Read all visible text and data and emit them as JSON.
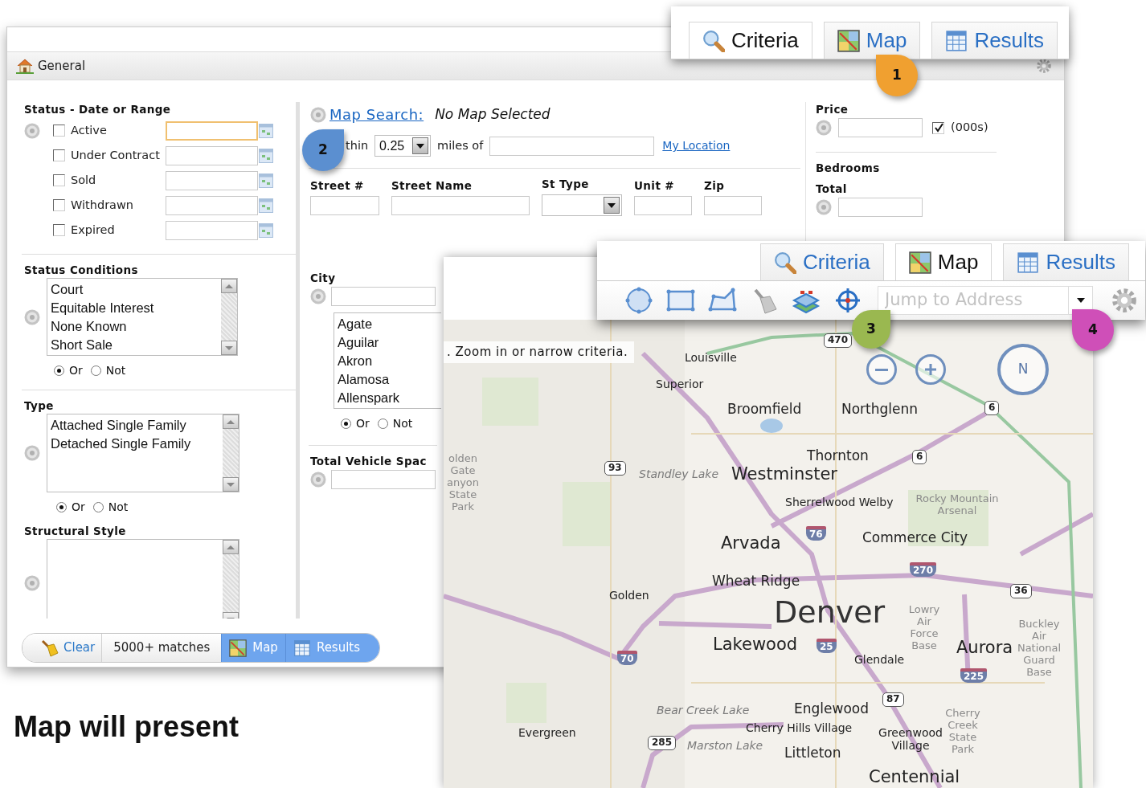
{
  "criteria_window": {
    "header": {
      "title": "General"
    },
    "status_dates": {
      "title": "Status - Date or Range",
      "items": [
        {
          "label": "Active",
          "checked": false,
          "focused": true
        },
        {
          "label": "Under Contract",
          "checked": false,
          "focused": false
        },
        {
          "label": "Sold",
          "checked": false,
          "focused": false
        },
        {
          "label": "Withdrawn",
          "checked": false,
          "focused": false
        },
        {
          "label": "Expired",
          "checked": false,
          "focused": false
        }
      ]
    },
    "status_conditions": {
      "title": "Status Conditions",
      "options": [
        "Court",
        "Equitable Interest",
        "None Known",
        "Short Sale"
      ],
      "logic": [
        {
          "label": "Or",
          "selected": true
        },
        {
          "label": "Not",
          "selected": false
        }
      ]
    },
    "type": {
      "title": "Type",
      "options": [
        "Attached Single Family",
        "Detached Single Family"
      ],
      "logic": [
        {
          "label": "Or",
          "selected": true
        },
        {
          "label": "Not",
          "selected": false
        }
      ]
    },
    "structural_style": {
      "title": "Structural Style"
    },
    "map_search": {
      "link": "Map Search:",
      "status": "No Map Selected",
      "within_label": "thin",
      "radius": "0.25",
      "miles_label": "miles of",
      "my_location": "My Location"
    },
    "address_fields": [
      {
        "label": "Street #",
        "kind": "text"
      },
      {
        "label": "Street Name",
        "kind": "text"
      },
      {
        "label": "St Type",
        "kind": "select"
      },
      {
        "label": "Unit #",
        "kind": "text"
      },
      {
        "label": "Zip",
        "kind": "text"
      }
    ],
    "city": {
      "title": "City",
      "options": [
        "Agate",
        "Aguilar",
        "Akron",
        "Alamosa",
        "Allenspark"
      ],
      "logic": [
        {
          "label": "Or",
          "selected": true
        },
        {
          "label": "Not",
          "selected": false
        }
      ]
    },
    "total_vehicle_spaces": {
      "title": "Total Vehicle Spac"
    },
    "price": {
      "title": "Price",
      "unit_label": "(000s)",
      "unit_checked": true
    },
    "bedrooms": {
      "title": "Bedrooms",
      "total_label": "Total"
    },
    "footer": {
      "clear": "Clear",
      "matches": "5000+ matches",
      "buttons": [
        {
          "label": "Map",
          "kind": "map"
        },
        {
          "label": "Results",
          "kind": "results"
        }
      ]
    }
  },
  "top_tabs": [
    {
      "label": "Criteria",
      "kind": "criteria",
      "selected": true
    },
    {
      "label": "Map",
      "kind": "map",
      "selected": false
    },
    {
      "label": "Results",
      "kind": "results",
      "selected": false
    }
  ],
  "map_window": {
    "tabs": [
      {
        "label": "Criteria",
        "kind": "criteria",
        "selected": false
      },
      {
        "label": "Map",
        "kind": "map",
        "selected": true
      },
      {
        "label": "Results",
        "kind": "results",
        "selected": false
      }
    ],
    "jump_placeholder": "Jump to Address",
    "message": ". Zoom in or narrow criteria.",
    "compass": "N",
    "labels": [
      {
        "text": "470",
        "kind": "state"
      },
      {
        "text": "Louisville",
        "kind": "city"
      },
      {
        "text": "Superior",
        "kind": "city"
      },
      {
        "text": "Broomfield",
        "kind": "major"
      },
      {
        "text": "Northglenn",
        "kind": "major"
      },
      {
        "text": "6",
        "kind": "us"
      },
      {
        "text": "olden Gate anyon State Park",
        "kind": "park"
      },
      {
        "text": "Thornton",
        "kind": "major"
      },
      {
        "text": "93",
        "kind": "state"
      },
      {
        "text": "Standley Lake",
        "kind": "water"
      },
      {
        "text": "Westminster",
        "kind": "big"
      },
      {
        "text": "6",
        "kind": "us"
      },
      {
        "text": "Sherrelwood Welby",
        "kind": "city"
      },
      {
        "text": "Rocky Mountain Arsenal",
        "kind": "park"
      },
      {
        "text": "Arvada",
        "kind": "big"
      },
      {
        "text": "76",
        "kind": "interstate"
      },
      {
        "text": "Commerce City",
        "kind": "major"
      },
      {
        "text": "270",
        "kind": "interstate"
      },
      {
        "text": "Wheat Ridge",
        "kind": "major"
      },
      {
        "text": "36",
        "kind": "us"
      },
      {
        "text": "Golden",
        "kind": "city"
      },
      {
        "text": "Denver",
        "kind": "metro"
      },
      {
        "text": "70",
        "kind": "interstate"
      },
      {
        "text": "Lakewood",
        "kind": "big"
      },
      {
        "text": "25",
        "kind": "interstate"
      },
      {
        "text": "Glendale",
        "kind": "city"
      },
      {
        "text": "Lowry Air Force Base",
        "kind": "park"
      },
      {
        "text": "Aurora",
        "kind": "big"
      },
      {
        "text": "225",
        "kind": "interstate"
      },
      {
        "text": "Buckley Air National Guard Base",
        "kind": "park"
      },
      {
        "text": "87",
        "kind": "us"
      },
      {
        "text": "Bear Creek Lake",
        "kind": "water"
      },
      {
        "text": "Englewood",
        "kind": "major"
      },
      {
        "text": "Evergreen",
        "kind": "city"
      },
      {
        "text": "Cherry Hills Village",
        "kind": "city"
      },
      {
        "text": "Greenwood Village",
        "kind": "city"
      },
      {
        "text": "Cherry Creek State Park",
        "kind": "park"
      },
      {
        "text": "285",
        "kind": "us"
      },
      {
        "text": "Marston Lake",
        "kind": "water"
      },
      {
        "text": "Littleton",
        "kind": "major"
      },
      {
        "text": "Centennial",
        "kind": "big"
      }
    ]
  },
  "callouts": [
    {
      "number": "1",
      "color": "#f0a030"
    },
    {
      "number": "2",
      "color": "#5b8fd0"
    },
    {
      "number": "3",
      "color": "#9ab850"
    },
    {
      "number": "4",
      "color": "#cf4fb8"
    }
  ],
  "caption": "Map will present"
}
